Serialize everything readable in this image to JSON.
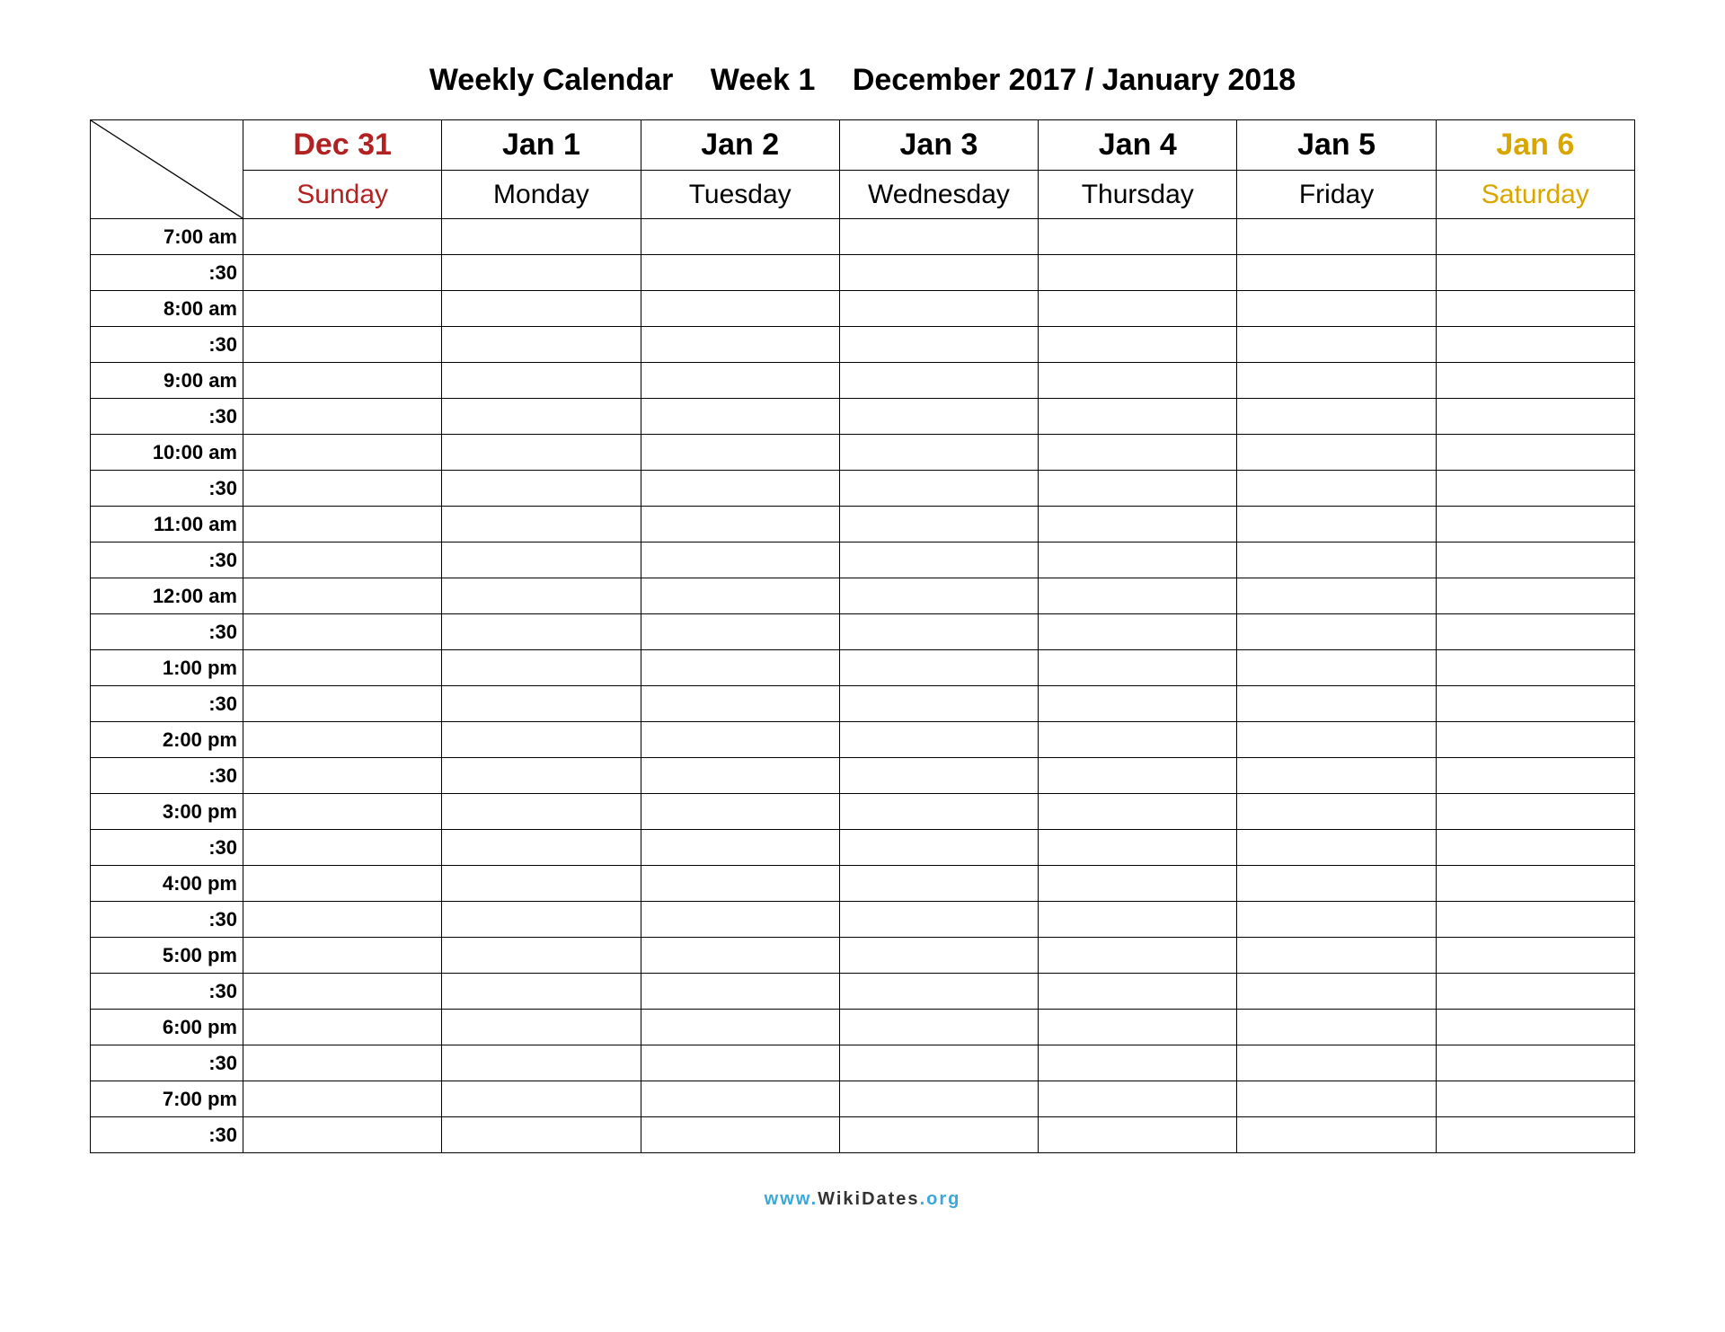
{
  "header": {
    "title": "Weekly Calendar",
    "week": "Week 1",
    "period": "December 2017 / January 2018"
  },
  "days": [
    {
      "date": "Dec 31",
      "name": "Sunday",
      "class": "sunday"
    },
    {
      "date": "Jan 1",
      "name": "Monday",
      "class": ""
    },
    {
      "date": "Jan 2",
      "name": "Tuesday",
      "class": ""
    },
    {
      "date": "Jan 3",
      "name": "Wednesday",
      "class": ""
    },
    {
      "date": "Jan 4",
      "name": "Thursday",
      "class": ""
    },
    {
      "date": "Jan 5",
      "name": "Friday",
      "class": ""
    },
    {
      "date": "Jan 6",
      "name": "Saturday",
      "class": "saturday"
    }
  ],
  "times": [
    "7:00 am",
    ":30",
    "8:00 am",
    ":30",
    "9:00 am",
    ":30",
    "10:00 am",
    ":30",
    "11:00 am",
    ":30",
    "12:00 am",
    ":30",
    "1:00 pm",
    ":30",
    "2:00 pm",
    ":30",
    "3:00 pm",
    ":30",
    "4:00 pm",
    ":30",
    "5:00 pm",
    ":30",
    "6:00 pm",
    ":30",
    "7:00 pm",
    ":30"
  ],
  "footer": {
    "prefix": "www.",
    "name": "WikiDates",
    "suffix": ".org"
  }
}
